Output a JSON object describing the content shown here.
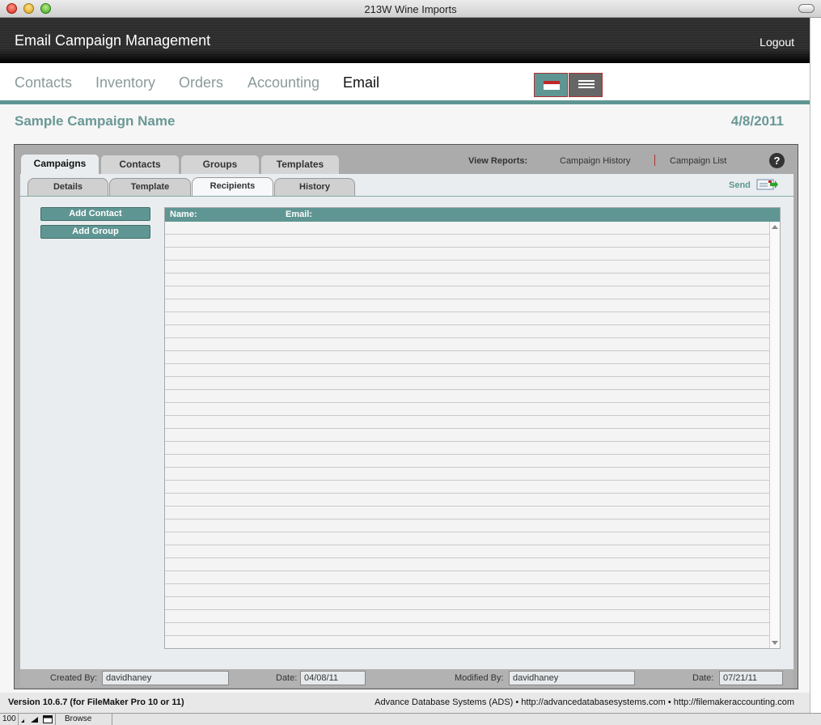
{
  "window": {
    "title": "213W Wine Imports"
  },
  "header": {
    "title": "Email Campaign Management",
    "logout": "Logout"
  },
  "nav": {
    "items": [
      "Contacts",
      "Inventory",
      "Orders",
      "Accounting",
      "Email"
    ],
    "active": "Email"
  },
  "campaign": {
    "name": "Sample Campaign Name",
    "date": "4/8/2011"
  },
  "tabs": [
    "Campaigns",
    "Contacts",
    "Groups",
    "Templates"
  ],
  "active_tab": "Campaigns",
  "reports": {
    "label": "View Reports:",
    "links": [
      "Campaign History",
      "Campaign List"
    ]
  },
  "help": "?",
  "subtabs": [
    "Details",
    "Template",
    "Recipients",
    "History"
  ],
  "active_subtab": "Recipients",
  "send": {
    "label": "Send"
  },
  "actions": {
    "add_contact": "Add Contact",
    "add_group": "Add Group"
  },
  "list": {
    "columns": [
      "Name:",
      "Email:"
    ]
  },
  "footer": {
    "created_by_label": "Created By:",
    "created_by": "davidhaney",
    "date_label": "Date:",
    "created_date": "04/08/11",
    "modified_by_label": "Modified By:",
    "modified_by": "davidhaney",
    "modified_date": "07/21/11"
  },
  "version": "Version 10.6.7 (for FileMaker Pro 10 or 11)",
  "credits": "Advance Database Systems (ADS) • http://advancedatabasesystems.com • http://filemakeraccounting.com",
  "statusbar": {
    "zoom": "100",
    "mode": "Browse"
  },
  "colors": {
    "accent": "#5f9693",
    "header": "#2c2c2c",
    "campaign_text": "#6a9896"
  }
}
